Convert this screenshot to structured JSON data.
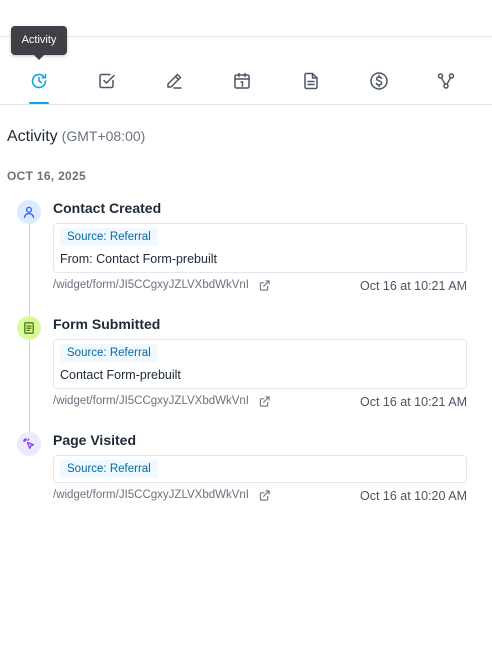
{
  "tooltip": "Activity",
  "tabs": [
    {
      "icon": "activity-clock-icon",
      "active": true
    },
    {
      "icon": "task-checkbox-icon",
      "active": false
    },
    {
      "icon": "note-pencil-icon",
      "active": false
    },
    {
      "icon": "calendar-icon",
      "active": false
    },
    {
      "icon": "document-icon",
      "active": false
    },
    {
      "icon": "dollar-icon",
      "active": false
    },
    {
      "icon": "workflow-icon",
      "active": false
    }
  ],
  "section": {
    "title": "Activity",
    "timezone": "(GMT+08:00)"
  },
  "date_label": "OCT 16, 2025",
  "events": [
    {
      "title": "Contact Created",
      "icon": "user-icon",
      "badge": "Source: Referral",
      "detail": "From: Contact Form-prebuilt",
      "link": "/widget/form/JI5CCgxyJZLVXbdWkVnI",
      "time": "Oct 16 at 10:21 AM"
    },
    {
      "title": "Form Submitted",
      "icon": "form-icon",
      "badge": "Source: Referral",
      "detail": "Contact Form-prebuilt",
      "link": "/widget/form/JI5CCgxyJZLVXbdWkVnI",
      "time": "Oct 16 at 10:21 AM"
    },
    {
      "title": "Page Visited",
      "icon": "cursor-click-icon",
      "badge": "Source: Referral",
      "detail": "",
      "link": "/widget/form/JI5CCgxyJZLVXbdWkVnI",
      "time": "Oct 16 at 10:20 AM"
    }
  ],
  "colors": {
    "accent": "#0ea5e9",
    "user_node": "#dbeafe",
    "form_node": "#d9f99d",
    "page_node": "#ede9fe"
  }
}
